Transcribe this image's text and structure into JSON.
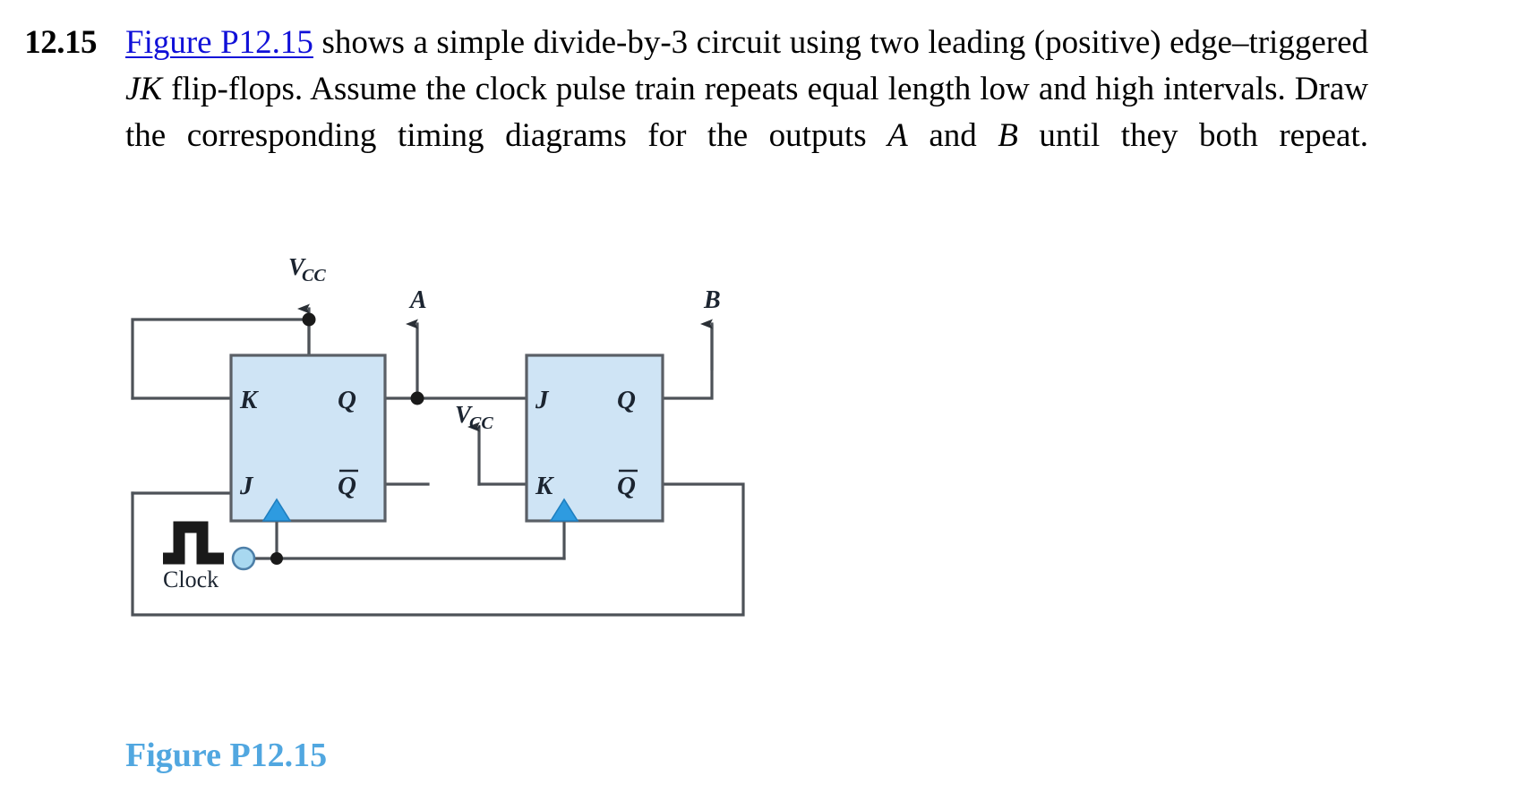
{
  "problem": {
    "number": "12.15",
    "link_text": "Figure P12.15",
    "text_part_1": " shows a simple divide-by-3 circuit using two leading (positive) edge–triggered ",
    "italic_1": "JK",
    "text_part_2": " flip-flops. Assume the clock pulse train repeats equal length low and high intervals. Draw the corresponding timing diagrams for the outputs ",
    "italic_2": "A",
    "text_part_3": " and ",
    "italic_3": "B",
    "text_part_4": " until they both repeat."
  },
  "figure": {
    "caption": "Figure P12.15",
    "clock_label": "Clock",
    "supply_left_label": "V",
    "supply_left_sub": "CC",
    "supply_mid_label": "V",
    "supply_mid_sub": "CC",
    "output_a_label": "A",
    "output_b_label": "B",
    "ff1": {
      "name": "flip-flop-1",
      "input_top": "K",
      "input_bottom": "J",
      "output_top": "Q",
      "output_bottom": "Q̅"
    },
    "ff2": {
      "name": "flip-flop-2",
      "input_top": "J",
      "input_bottom": "K",
      "output_top": "Q",
      "output_bottom": "Q̅"
    }
  },
  "colors": {
    "link": "#1010d8",
    "caption": "#51a7e0",
    "block_fill": "#cfe4f5",
    "block_stroke": "#5a5f66",
    "wire": "#4d5258",
    "clock_symbol": "#1a1a1a",
    "edge_triangle": "#2e9be0",
    "terminal_circle": "#a8d8f0",
    "text": "#1b2430"
  }
}
